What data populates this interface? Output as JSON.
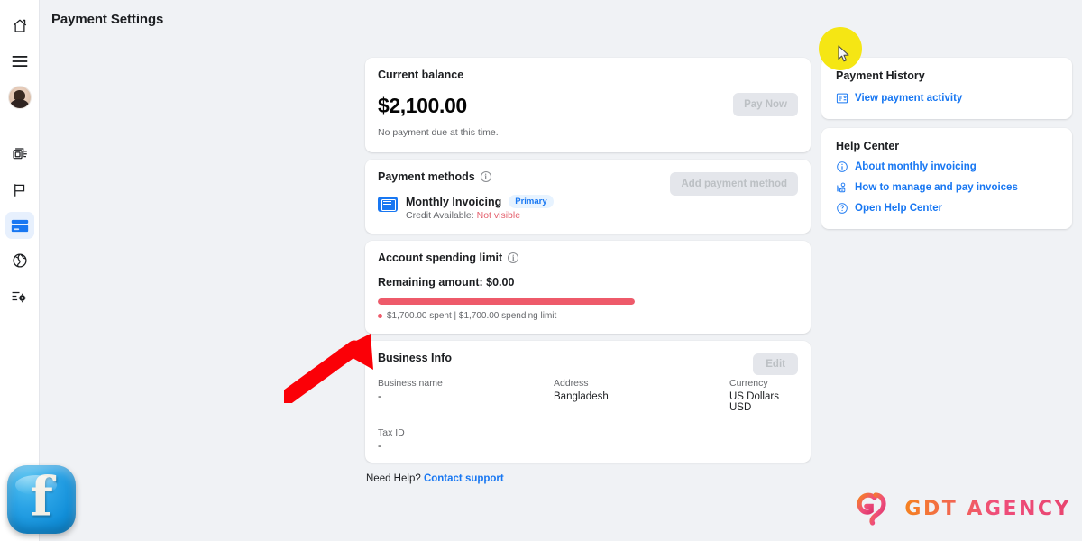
{
  "page": {
    "title": "Payment Settings",
    "background_color": "#f0f2f5",
    "accent_color": "#1877f2",
    "danger_color": "#ee5a6a"
  },
  "rail": {
    "items": [
      {
        "name": "home",
        "icon": "home-icon",
        "active": false
      },
      {
        "name": "menu",
        "icon": "hamburger-menu-icon",
        "active": false
      },
      {
        "name": "account",
        "icon": "avatar",
        "active": false
      },
      {
        "name": "campaigns",
        "icon": "campaigns-icon",
        "active": false
      },
      {
        "name": "ads",
        "icon": "flag-icon",
        "active": false
      },
      {
        "name": "billing",
        "icon": "credit-card-icon",
        "active": true
      },
      {
        "name": "globe",
        "icon": "globe-icon",
        "active": false
      },
      {
        "name": "settings",
        "icon": "settings-sliders-icon",
        "active": false
      }
    ]
  },
  "balance_card": {
    "title": "Current balance",
    "amount": "$2,100.00",
    "note": "No payment due at this time.",
    "button": "Pay Now"
  },
  "payment_methods_card": {
    "title": "Payment methods",
    "info_glyph": "i",
    "button": "Add payment method",
    "method": {
      "name": "Monthly Invoicing",
      "badge": "Primary",
      "credit_label": "Credit Available:",
      "credit_value": "Not visible"
    }
  },
  "spending_limit_card": {
    "title": "Account spending limit",
    "info_glyph": "i",
    "remaining": "Remaining amount: $0.00",
    "progress_percent": 100,
    "legend": "$1,700.00 spent | $1,700.00 spending limit"
  },
  "business_info_card": {
    "title": "Business Info",
    "button": "Edit",
    "fields": [
      {
        "label": "Business name",
        "value": "-"
      },
      {
        "label": "Address",
        "value": "Bangladesh"
      },
      {
        "label": "Currency",
        "value": "US Dollars USD"
      },
      {
        "label": "Tax ID",
        "value": "-"
      }
    ]
  },
  "footer": {
    "need_help": "Need Help?",
    "contact_support": "Contact support"
  },
  "payment_history_card": {
    "title": "Payment History",
    "link": "View payment activity",
    "link_icon": "receipt-icon"
  },
  "help_center_card": {
    "title": "Help Center",
    "links": [
      {
        "label": "About monthly invoicing",
        "icon": "info-circle-icon"
      },
      {
        "label": "How to manage and pay invoices",
        "icon": "person-card-icon"
      },
      {
        "label": "Open Help Center",
        "icon": "question-circle-icon"
      }
    ]
  },
  "annotations": {
    "cursor_highlight": {
      "name": "cursor-highlight-circle",
      "color": "#f5e614"
    },
    "cursor": {
      "name": "mouse-cursor-arrow"
    },
    "red_arrow": {
      "name": "red-annotation-arrow",
      "color": "#fb0007"
    }
  },
  "branding": {
    "facebook": {
      "glyph": "f",
      "color": "#1f9ae0"
    },
    "gdt": {
      "text": "GDT AGENCY",
      "gradient_from": "#f58220",
      "gradient_to": "#e8456f"
    }
  }
}
